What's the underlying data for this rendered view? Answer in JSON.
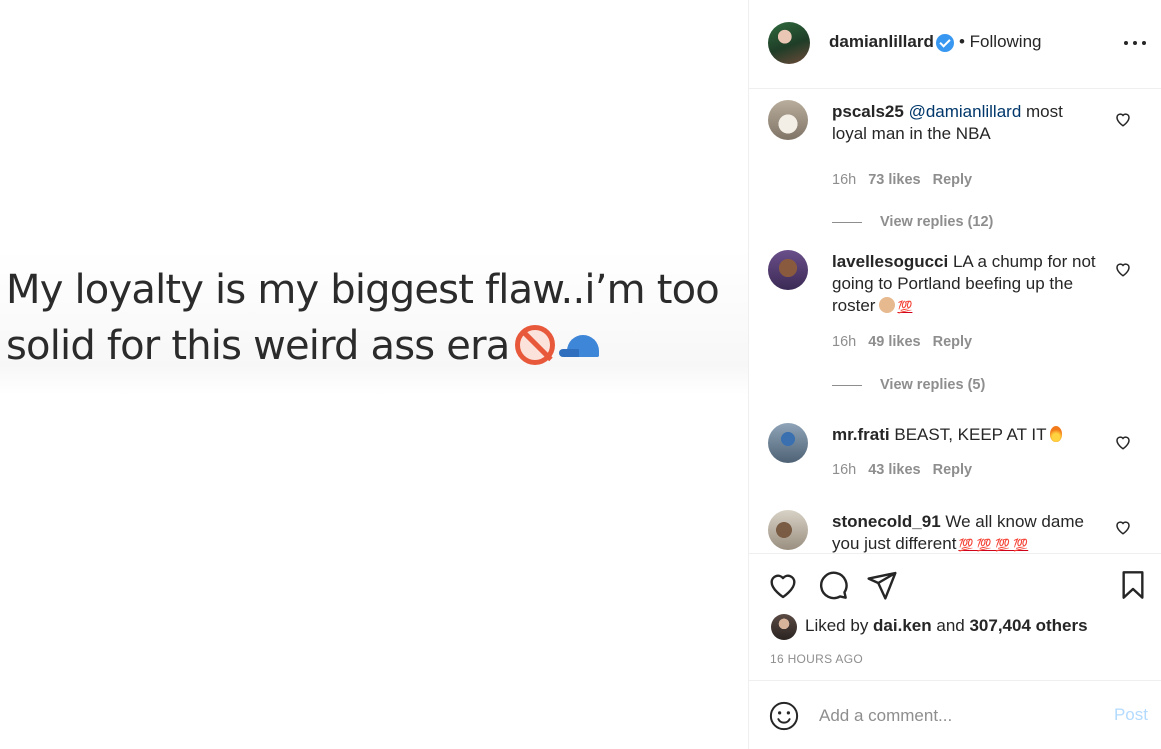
{
  "media": {
    "caption_line1": "My loyalty is my biggest flaw..i’m too",
    "caption_line2": "solid for this weird ass era",
    "emoji_icons": [
      "no-entry-icon",
      "cap-icon"
    ]
  },
  "header": {
    "username": "damianlillard",
    "verified": true,
    "following_label": "• Following",
    "more_icon": "more-horizontal-icon"
  },
  "comments": [
    {
      "username": "pscals25",
      "mention": "@damianlillard",
      "text": " most loyal man in the NBA",
      "time": "16h",
      "likes": "73 likes",
      "reply": "Reply",
      "view_replies": "View replies (12)"
    },
    {
      "username": "lavellesogucci",
      "text": " LA a chump for not going to Portland beefing up the roster",
      "emojis": "💯",
      "time": "16h",
      "likes": "49 likes",
      "reply": "Reply",
      "view_replies": "View replies (5)"
    },
    {
      "username": "mr.frati",
      "text": " BEAST, KEEP AT IT",
      "emojis": "🔥",
      "time": "16h",
      "likes": "43 likes",
      "reply": "Reply"
    },
    {
      "username": "stonecold_91",
      "text": " We all know dame you just different",
      "emojis": "💯 💯 💯 💯"
    }
  ],
  "actions": {
    "liked_by_prefix": "Liked by ",
    "liked_by_user": "dai.ken",
    "liked_by_and": " and ",
    "liked_by_others": "307,404 others",
    "timestamp": "16 HOURS AGO"
  },
  "add_comment": {
    "placeholder": "Add a comment...",
    "post_label": "Post"
  },
  "colors": {
    "link": "#00376b",
    "verified": "#3897f0",
    "muted": "#8e8e8e",
    "post_disabled": "#b3dbff"
  }
}
